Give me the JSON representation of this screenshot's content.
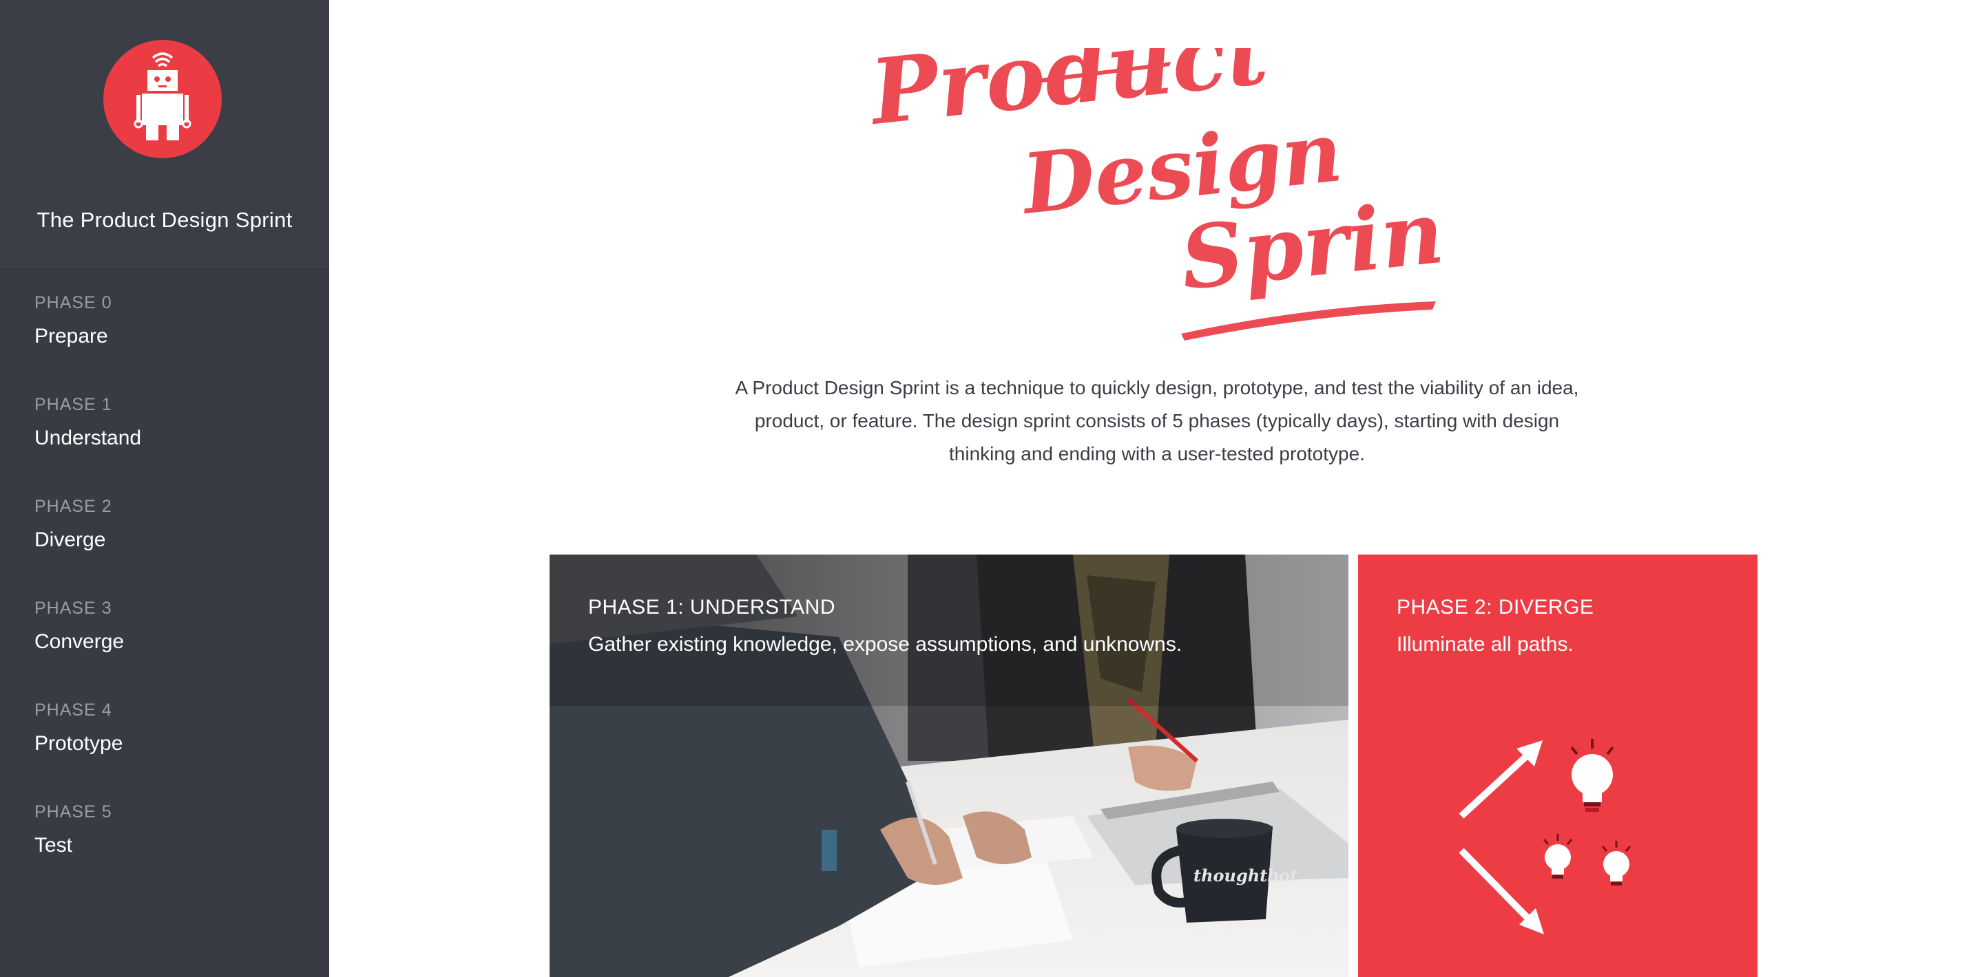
{
  "sidebar": {
    "brand_title": "The Product Design Sprint",
    "items": [
      {
        "phase": "PHASE 0",
        "name": "Prepare"
      },
      {
        "phase": "PHASE 1",
        "name": "Understand"
      },
      {
        "phase": "PHASE 2",
        "name": "Diverge"
      },
      {
        "phase": "PHASE 3",
        "name": "Converge"
      },
      {
        "phase": "PHASE 4",
        "name": "Prototype"
      },
      {
        "phase": "PHASE 5",
        "name": "Test"
      }
    ]
  },
  "hero": {
    "logo_line1": "Product",
    "logo_line2": "Design",
    "logo_line3": "Sprint"
  },
  "intro": {
    "text": "A Product Design Sprint is a technique to quickly design, prototype, and test the viability of an idea, product, or feature. The design sprint consists of 5 phases (typically days), starting with design thinking and ending with a user-tested prototype."
  },
  "cards": [
    {
      "title": "PHASE 1: UNDERSTAND",
      "subtitle": "Gather existing knowledge, expose assumptions, and unknowns.",
      "mug_text": "thoughtbot"
    },
    {
      "title": "PHASE 2: DIVERGE",
      "subtitle": "Illuminate all paths."
    }
  ],
  "colors": {
    "accent": "#ec3c43",
    "sidebar_bg": "#393b44",
    "text_dark": "#3b3d45"
  },
  "icons": {
    "logo": "robot-icon",
    "diverge": "arrows-lightbulbs-icon"
  }
}
